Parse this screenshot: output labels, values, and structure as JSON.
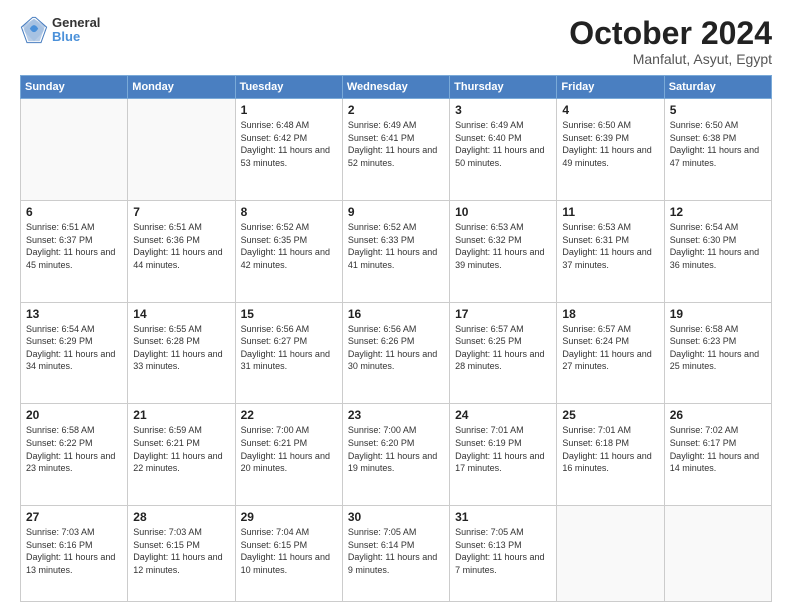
{
  "header": {
    "logo_line1": "General",
    "logo_line2": "Blue",
    "title": "October 2024",
    "subtitle": "Manfalut, Asyut, Egypt"
  },
  "weekdays": [
    "Sunday",
    "Monday",
    "Tuesday",
    "Wednesday",
    "Thursday",
    "Friday",
    "Saturday"
  ],
  "weeks": [
    [
      {
        "day": "",
        "detail": ""
      },
      {
        "day": "",
        "detail": ""
      },
      {
        "day": "1",
        "detail": "Sunrise: 6:48 AM\nSunset: 6:42 PM\nDaylight: 11 hours and 53 minutes."
      },
      {
        "day": "2",
        "detail": "Sunrise: 6:49 AM\nSunset: 6:41 PM\nDaylight: 11 hours and 52 minutes."
      },
      {
        "day": "3",
        "detail": "Sunrise: 6:49 AM\nSunset: 6:40 PM\nDaylight: 11 hours and 50 minutes."
      },
      {
        "day": "4",
        "detail": "Sunrise: 6:50 AM\nSunset: 6:39 PM\nDaylight: 11 hours and 49 minutes."
      },
      {
        "day": "5",
        "detail": "Sunrise: 6:50 AM\nSunset: 6:38 PM\nDaylight: 11 hours and 47 minutes."
      }
    ],
    [
      {
        "day": "6",
        "detail": "Sunrise: 6:51 AM\nSunset: 6:37 PM\nDaylight: 11 hours and 45 minutes."
      },
      {
        "day": "7",
        "detail": "Sunrise: 6:51 AM\nSunset: 6:36 PM\nDaylight: 11 hours and 44 minutes."
      },
      {
        "day": "8",
        "detail": "Sunrise: 6:52 AM\nSunset: 6:35 PM\nDaylight: 11 hours and 42 minutes."
      },
      {
        "day": "9",
        "detail": "Sunrise: 6:52 AM\nSunset: 6:33 PM\nDaylight: 11 hours and 41 minutes."
      },
      {
        "day": "10",
        "detail": "Sunrise: 6:53 AM\nSunset: 6:32 PM\nDaylight: 11 hours and 39 minutes."
      },
      {
        "day": "11",
        "detail": "Sunrise: 6:53 AM\nSunset: 6:31 PM\nDaylight: 11 hours and 37 minutes."
      },
      {
        "day": "12",
        "detail": "Sunrise: 6:54 AM\nSunset: 6:30 PM\nDaylight: 11 hours and 36 minutes."
      }
    ],
    [
      {
        "day": "13",
        "detail": "Sunrise: 6:54 AM\nSunset: 6:29 PM\nDaylight: 11 hours and 34 minutes."
      },
      {
        "day": "14",
        "detail": "Sunrise: 6:55 AM\nSunset: 6:28 PM\nDaylight: 11 hours and 33 minutes."
      },
      {
        "day": "15",
        "detail": "Sunrise: 6:56 AM\nSunset: 6:27 PM\nDaylight: 11 hours and 31 minutes."
      },
      {
        "day": "16",
        "detail": "Sunrise: 6:56 AM\nSunset: 6:26 PM\nDaylight: 11 hours and 30 minutes."
      },
      {
        "day": "17",
        "detail": "Sunrise: 6:57 AM\nSunset: 6:25 PM\nDaylight: 11 hours and 28 minutes."
      },
      {
        "day": "18",
        "detail": "Sunrise: 6:57 AM\nSunset: 6:24 PM\nDaylight: 11 hours and 27 minutes."
      },
      {
        "day": "19",
        "detail": "Sunrise: 6:58 AM\nSunset: 6:23 PM\nDaylight: 11 hours and 25 minutes."
      }
    ],
    [
      {
        "day": "20",
        "detail": "Sunrise: 6:58 AM\nSunset: 6:22 PM\nDaylight: 11 hours and 23 minutes."
      },
      {
        "day": "21",
        "detail": "Sunrise: 6:59 AM\nSunset: 6:21 PM\nDaylight: 11 hours and 22 minutes."
      },
      {
        "day": "22",
        "detail": "Sunrise: 7:00 AM\nSunset: 6:21 PM\nDaylight: 11 hours and 20 minutes."
      },
      {
        "day": "23",
        "detail": "Sunrise: 7:00 AM\nSunset: 6:20 PM\nDaylight: 11 hours and 19 minutes."
      },
      {
        "day": "24",
        "detail": "Sunrise: 7:01 AM\nSunset: 6:19 PM\nDaylight: 11 hours and 17 minutes."
      },
      {
        "day": "25",
        "detail": "Sunrise: 7:01 AM\nSunset: 6:18 PM\nDaylight: 11 hours and 16 minutes."
      },
      {
        "day": "26",
        "detail": "Sunrise: 7:02 AM\nSunset: 6:17 PM\nDaylight: 11 hours and 14 minutes."
      }
    ],
    [
      {
        "day": "27",
        "detail": "Sunrise: 7:03 AM\nSunset: 6:16 PM\nDaylight: 11 hours and 13 minutes."
      },
      {
        "day": "28",
        "detail": "Sunrise: 7:03 AM\nSunset: 6:15 PM\nDaylight: 11 hours and 12 minutes."
      },
      {
        "day": "29",
        "detail": "Sunrise: 7:04 AM\nSunset: 6:15 PM\nDaylight: 11 hours and 10 minutes."
      },
      {
        "day": "30",
        "detail": "Sunrise: 7:05 AM\nSunset: 6:14 PM\nDaylight: 11 hours and 9 minutes."
      },
      {
        "day": "31",
        "detail": "Sunrise: 7:05 AM\nSunset: 6:13 PM\nDaylight: 11 hours and 7 minutes."
      },
      {
        "day": "",
        "detail": ""
      },
      {
        "day": "",
        "detail": ""
      }
    ]
  ]
}
